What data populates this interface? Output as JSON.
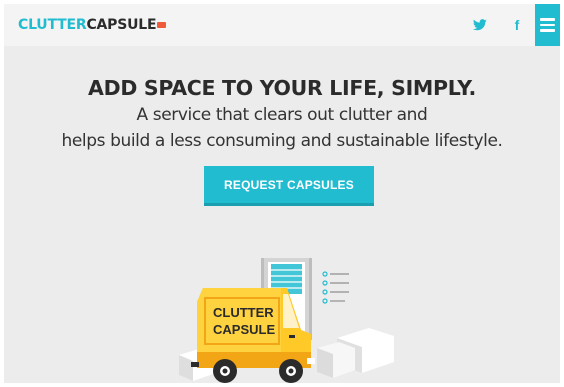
{
  "header": {
    "logo_part1": "CLUTTER",
    "logo_part2": "CAPSULE",
    "social": [
      {
        "icon": "twitter-icon",
        "label": ""
      },
      {
        "icon": "facebook-icon",
        "label": "f"
      }
    ],
    "menu_icon": "hamburger-menu-icon"
  },
  "hero": {
    "headline": "ADD SPACE TO YOUR LIFE, SIMPLY.",
    "subline_1": "A service that clears out clutter and",
    "subline_2": "helps build a less consuming and sustainable lifestyle.",
    "cta_label": "REQUEST CAPSULES"
  },
  "illustration": {
    "truck_text_1": "CLUTTER",
    "truck_text_2": "CAPSULE"
  },
  "colors": {
    "accent": "#22bcd0",
    "background": "#ececec",
    "truck": "#ffd23f",
    "text": "#2b2b2b"
  }
}
